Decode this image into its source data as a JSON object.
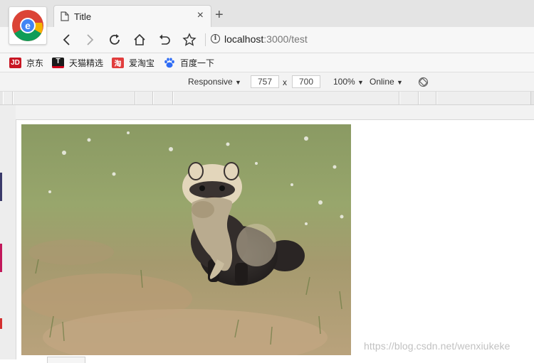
{
  "tab": {
    "title": "Title",
    "close_glyph": "×",
    "new_tab_glyph": "+"
  },
  "address_bar": {
    "host": "localhost",
    "path": ":3000/test"
  },
  "bookmarks": [
    {
      "label": "京东",
      "icon": "jd-icon",
      "icon_text": "JD",
      "color": "#c81623"
    },
    {
      "label": "天猫精选",
      "icon": "tmall-icon",
      "icon_text": "T",
      "color": "#d1011c"
    },
    {
      "label": "爱淘宝",
      "icon": "taobao-icon",
      "icon_text": "淘",
      "color": "#e13d3d"
    },
    {
      "label": "百度一下",
      "icon": "baidu-paw-icon",
      "icon_text": "",
      "color": "#2f6cf5"
    }
  ],
  "device_toolbar": {
    "mode": "Responsive",
    "width": "757",
    "times": "x",
    "height": "700",
    "zoom": "100%",
    "network": "Online",
    "caret": "▼"
  },
  "content": {
    "image": "ferret-holding-prey-photo"
  },
  "watermark": "https://blog.csdn.net/wenxiukeke",
  "colors": {
    "tabstrip_bg": "#e4e4e4",
    "toolbar_bg": "#f7f7f7",
    "accent_blue": "#2f6cf5"
  }
}
